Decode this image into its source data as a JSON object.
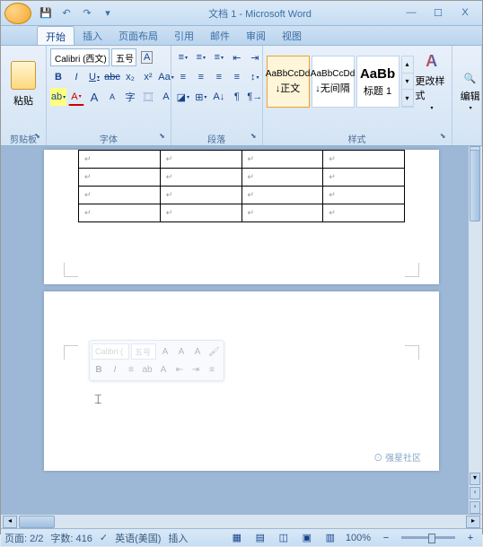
{
  "window": {
    "title": "文档 1 - Microsoft Word"
  },
  "quick_access": {
    "save": "💾",
    "undo": "↶",
    "redo": "↷",
    "more": "▾"
  },
  "win_controls": {
    "min": "—",
    "max": "☐",
    "close": "X"
  },
  "tabs": {
    "home": "开始",
    "insert": "插入",
    "page_layout": "页面布局",
    "references": "引用",
    "mailings": "邮件",
    "review": "审阅",
    "view": "视图"
  },
  "clipboard": {
    "paste": "粘贴",
    "label": "剪贴板",
    "cut": "✂",
    "copy": "📄",
    "format": "🖌"
  },
  "font": {
    "name": "Calibri (西文)",
    "size": "五号",
    "grow": "A",
    "shrink": "A",
    "clear": "A",
    "bold": "B",
    "italic": "I",
    "underline": "U",
    "strike": "abc",
    "sub": "x₂",
    "sup": "x²",
    "case": "Aa",
    "highlight": "ab",
    "color": "A",
    "phonetic": "字",
    "border": "⿴",
    "charshade": "A",
    "label": "字体"
  },
  "paragraph": {
    "bullets": "≡",
    "numbering": "≡",
    "multilevel": "≡",
    "indent_dec": "⇤",
    "indent_inc": "⇥",
    "align_l": "≡",
    "align_c": "≡",
    "align_r": "≡",
    "justify": "≡",
    "linespace": "↕",
    "shade": "◪",
    "border": "⊞",
    "sort": "A↓",
    "showmarks": "¶",
    "ltr": "¶→",
    "rtl": "←¶",
    "label": "段落"
  },
  "styles": {
    "items": [
      {
        "preview": "AaBbCcDd",
        "name": "↓正文"
      },
      {
        "preview": "AaBbCcDd",
        "name": "↓无间隔"
      },
      {
        "preview": "AaBb",
        "name": "标题 1"
      }
    ],
    "change": "更改样式",
    "label": "样式"
  },
  "editing": {
    "label": "编辑",
    "find": "🔍"
  },
  "table": {
    "rows": 4,
    "cols": 4,
    "cell_marker": "↵"
  },
  "mini_toolbar": {
    "font": "Calibri (",
    "size": "五号",
    "grow": "A",
    "shrink": "A",
    "styles": "A",
    "format": "🖌",
    "bold": "B",
    "italic": "I",
    "center": "≡",
    "highlight": "ab",
    "color": "A",
    "indent_dec": "⇤",
    "indent_inc": "⇥",
    "list": "≡"
  },
  "status": {
    "page": "页面: 2/2",
    "words": "字数: 416",
    "checkicon": "✓",
    "lang": "英语(美国)",
    "mode": "插入",
    "view1": "▦",
    "view2": "▤",
    "view3": "◫",
    "view4": "▣",
    "view5": "▥",
    "zoom": "100%",
    "minus": "−",
    "plus": "+"
  },
  "watermark": "⊙ 强星社区"
}
